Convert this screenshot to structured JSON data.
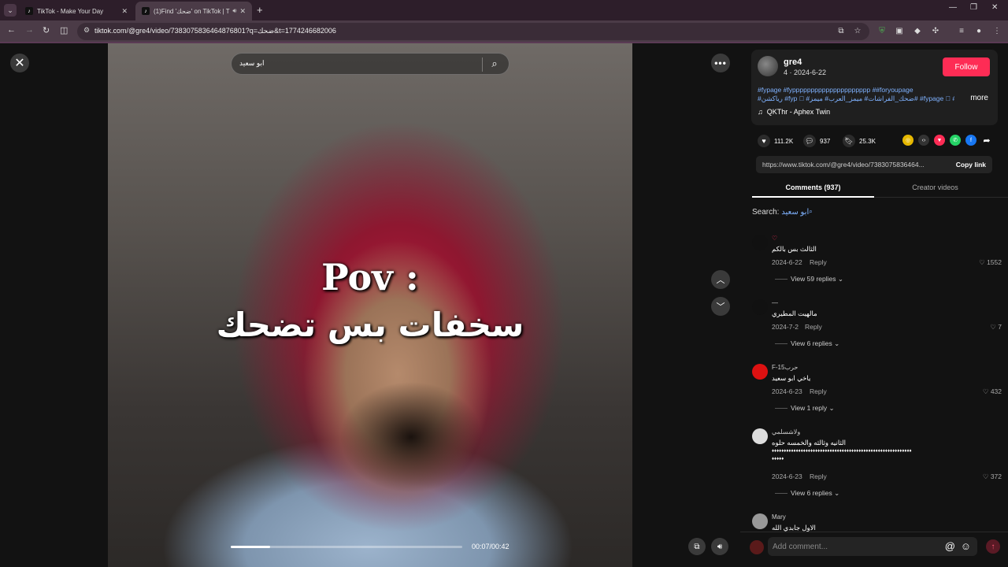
{
  "browser": {
    "tabs": [
      {
        "title": "TikTok - Make Your Day"
      },
      {
        "title": "(1)Find 'ضحك' on TikTok | T"
      }
    ],
    "url": "tiktok.com/@gre4/video/7383075836464876801?q=ضحك&t=1774246682006"
  },
  "video": {
    "search_query": "ابو سعيد",
    "caption_line1": "Pov :",
    "caption_line2": "سخفات بس تضحك",
    "time": "00:07/00:42",
    "progress_fraction": 0.17
  },
  "author": {
    "username": "gre4",
    "meta": "4 · 2024-6-22",
    "follow_label": "Follow",
    "hashtags_line1": "#fypage #fyppppppppppppppppppppp ##foryoupage",
    "hashtags_line2": "#رياكشن #fyp ゚ #ضحك_الفراشات# ميمز_العرب# ميمز# #fypage ゚ #foryou...",
    "more_label": "more",
    "music": "QKThr - Aphex Twin"
  },
  "stats": {
    "likes": "111.2K",
    "comments": "937",
    "saves": "25.3K"
  },
  "share": {
    "link": "https://www.tiktok.com/@gre4/video/7383075836464...",
    "copy_label": "Copy link"
  },
  "panel_tabs": {
    "comments": "Comments (937)",
    "creator": "Creator videos"
  },
  "comment_search": {
    "label": "Search:",
    "keyword": "ابو سعيد"
  },
  "comments": [
    {
      "name": "♡",
      "text": "الثالث بس بالكم",
      "date": "2024-6-22",
      "reply": "Reply",
      "likes": "1552",
      "view_replies": "View 59 replies"
    },
    {
      "name": "—",
      "text": "مالهيت المطيري",
      "date": "2024-7-2",
      "reply": "Reply",
      "likes": "7",
      "view_replies": "View 6 replies"
    },
    {
      "name": "F-15حرب",
      "text": "ياخي ابو سعيد",
      "date": "2024-6-23",
      "reply": "Reply",
      "likes": "432",
      "view_replies": "View 1 reply"
    },
    {
      "name": "ولاشسلمي",
      "text": "الثانيه وثالثه والخمسه حلوه",
      "text2": "♦♦♦♦♦♦♦♦♦♦♦♦♦♦♦♦♦♦♦♦♦♦♦♦♦♦♦♦♦♦♦♦♦♦♦♦♦♦♦♦♦♦♦♦♦♦♦♦♦♦♦♦♦♦♦♦♦♦",
      "text3": "♦♦♦♦♦",
      "date": "2024-6-23",
      "reply": "Reply",
      "likes": "372",
      "view_replies": "View 6 replies"
    },
    {
      "name": "Mary",
      "text": "الاول جابدي الله"
    }
  ],
  "add_comment": {
    "placeholder": "Add comment..."
  }
}
